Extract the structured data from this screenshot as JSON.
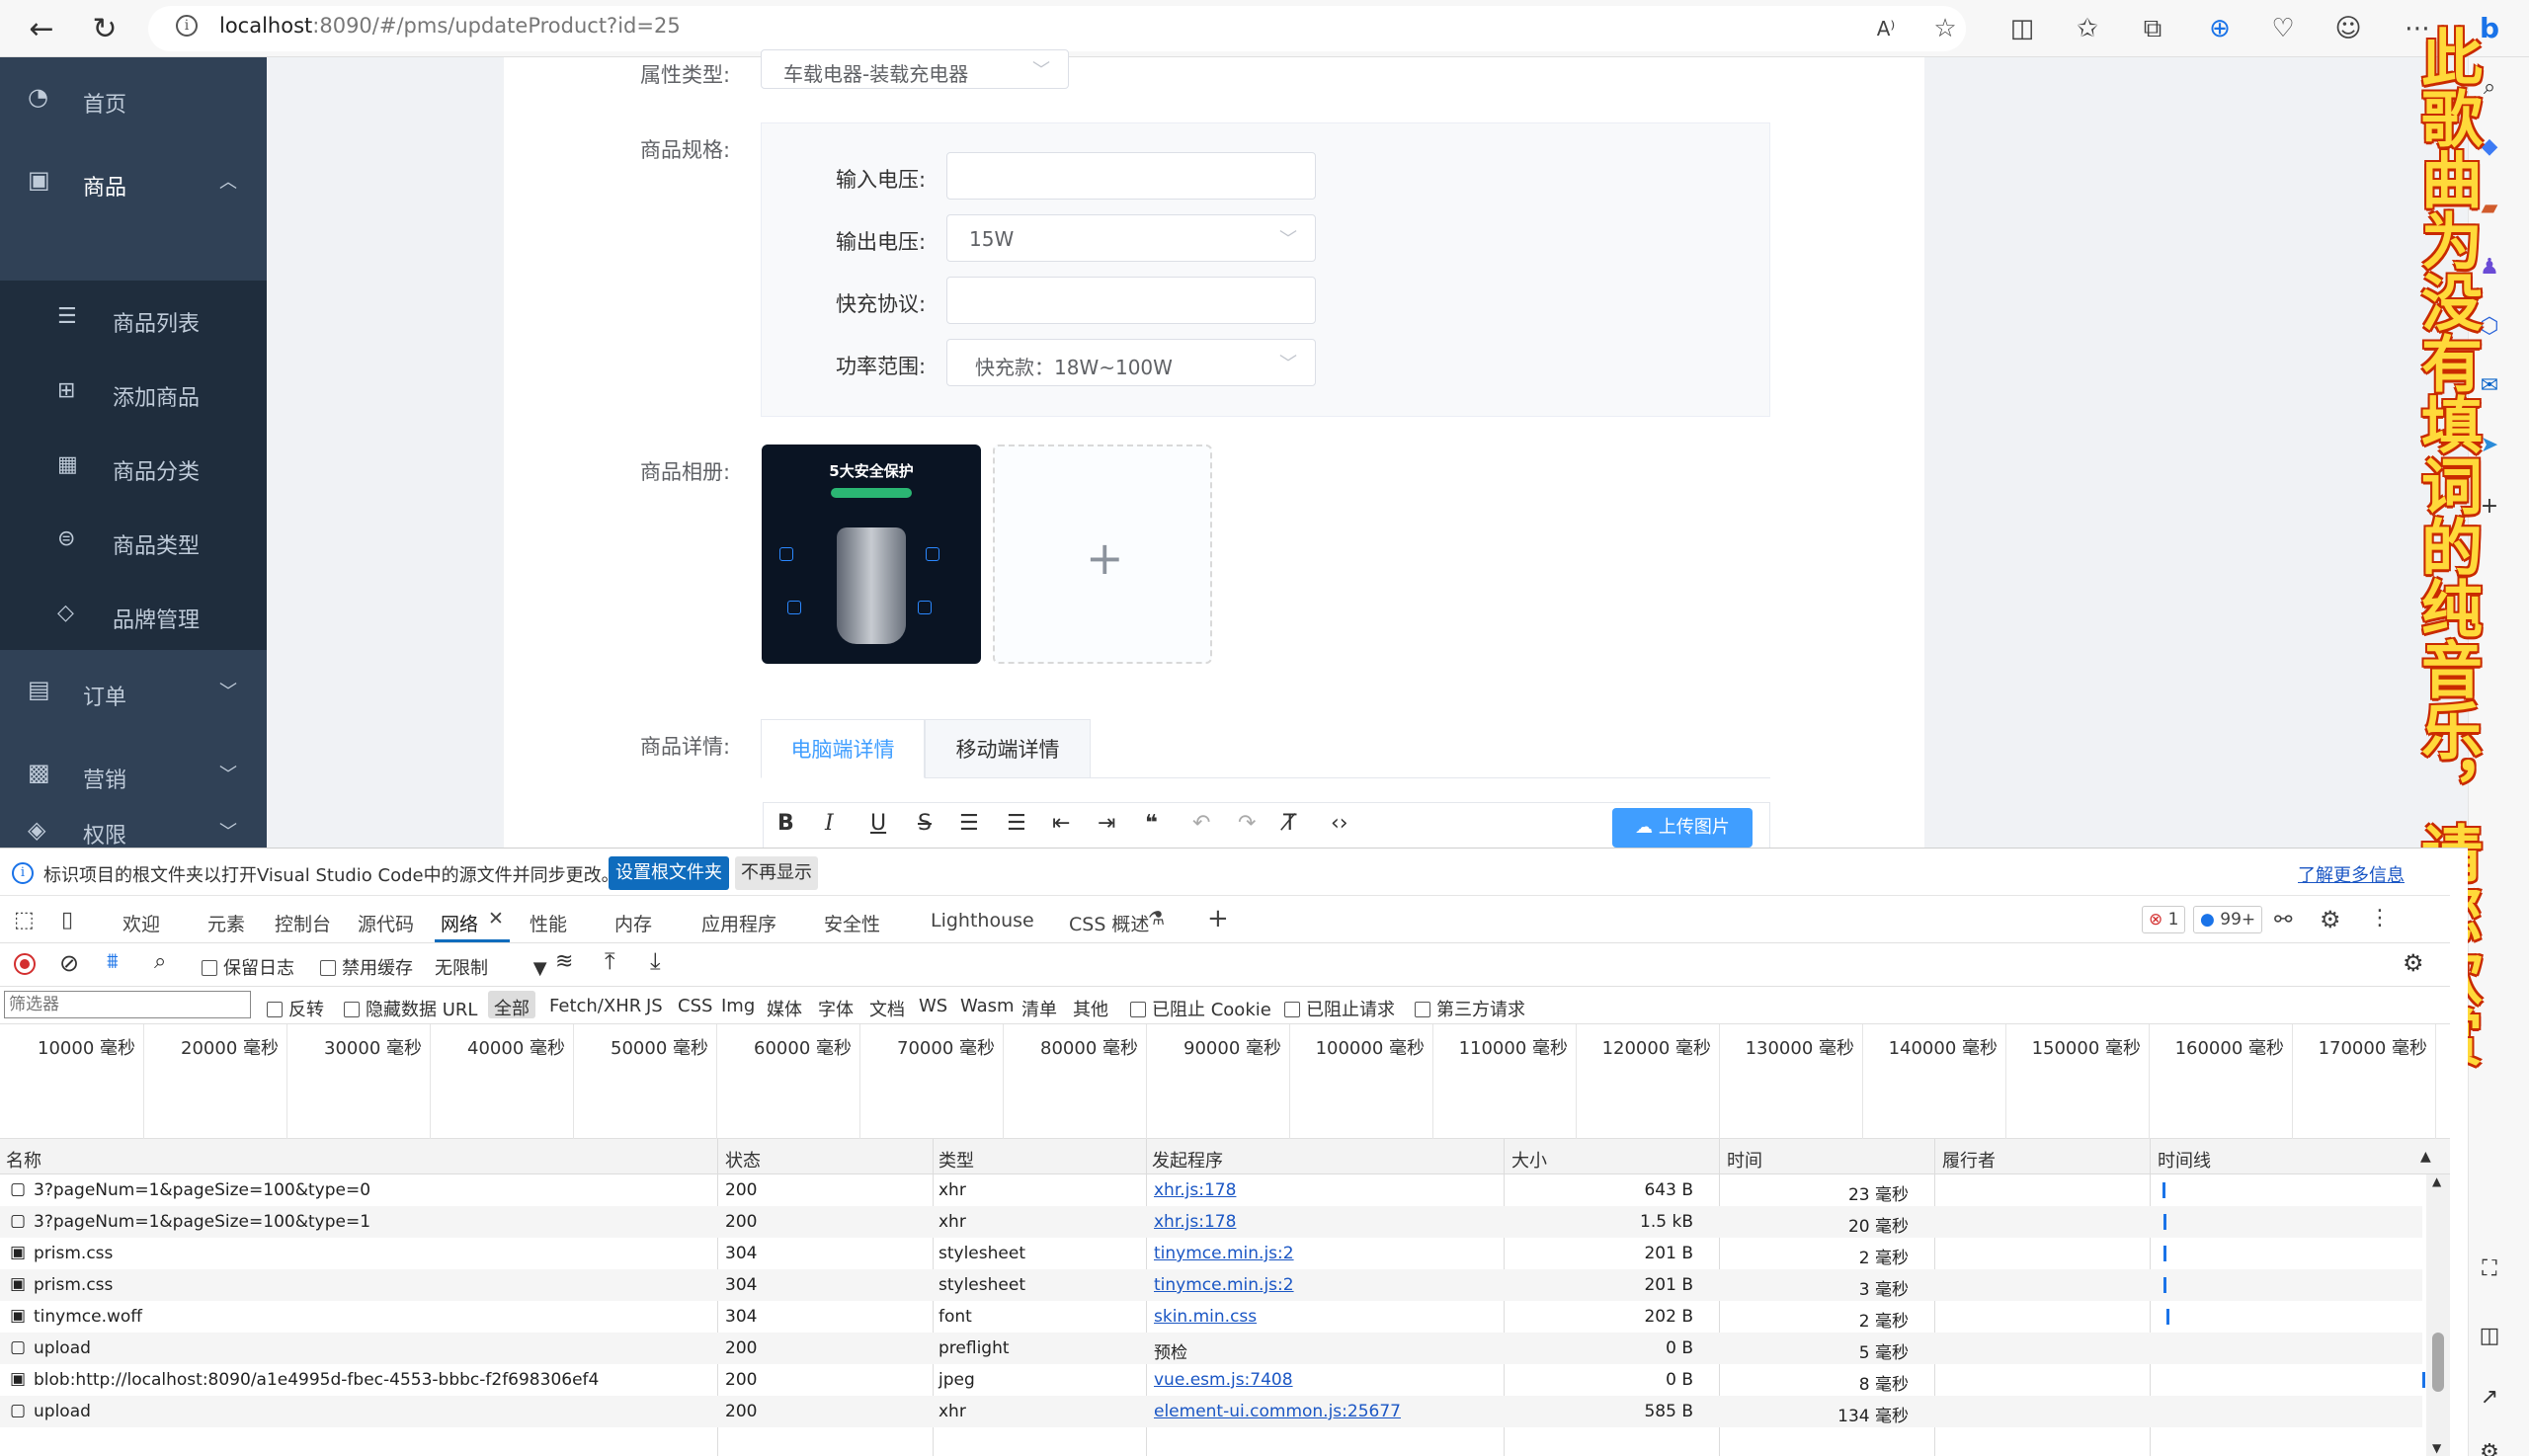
{
  "browser": {
    "url_host": "localhost",
    "url_path": ":8090/#/pms/updateProduct?id=25"
  },
  "sidebar": {
    "home": "首页",
    "product": "商品",
    "sub": [
      {
        "label": "商品列表",
        "icon": "list-icon"
      },
      {
        "label": "添加商品",
        "icon": "add-icon"
      },
      {
        "label": "商品分类",
        "icon": "grid-icon"
      },
      {
        "label": "商品类型",
        "icon": "type-icon"
      },
      {
        "label": "品牌管理",
        "icon": "tag-icon"
      }
    ],
    "order": "订单",
    "marketing": "营销",
    "permission": "权限"
  },
  "form": {
    "attr_type_label": "属性类型:",
    "attr_type_value": "车载电器-装载充电器",
    "spec_label": "商品规格:",
    "spec_rows": [
      {
        "label": "输入电压:",
        "value": "",
        "kind": "input"
      },
      {
        "label": "输出电压:",
        "value": "15W",
        "kind": "select"
      },
      {
        "label": "快充协议:",
        "value": "",
        "kind": "input"
      },
      {
        "label": "功率范围:",
        "value": "快充款：18W~100W",
        "kind": "select"
      }
    ],
    "album_label": "商品相册:",
    "album_image_title": "5大安全保护",
    "detail_label": "商品详情:",
    "tabs": [
      "电脑端详情",
      "移动端详情"
    ],
    "upload_button": "上传图片"
  },
  "lyrics": "此歌曲为没有填词的纯音乐，请您欣赏",
  "devtools": {
    "info_text": "标识项目的根文件夹以打开Visual Studio Code中的源文件并同步更改。",
    "info_set_button": "设置根文件夹",
    "info_dismiss_button": "不再显示",
    "info_learn_more": "了解更多信息",
    "tabs": [
      "欢迎",
      "元素",
      "控制台",
      "源代码",
      "网络",
      "性能",
      "内存",
      "应用程序",
      "安全性",
      "Lighthouse",
      "CSS 概述"
    ],
    "active_tab": "网络",
    "error_count": "1",
    "message_count": "99+",
    "toolbar": {
      "preserve_log": "保留日志",
      "disable_cache": "禁用缓存",
      "throttle": "无限制"
    },
    "filter": {
      "placeholder": "筛选器",
      "invert": "反转",
      "hide_data_urls": "隐藏数据 URL",
      "types": [
        "全部",
        "Fetch/XHR",
        "JS",
        "CSS",
        "Img",
        "媒体",
        "字体",
        "文档",
        "WS",
        "Wasm",
        "清单",
        "其他"
      ],
      "blocked_cookies": "已阻止 Cookie",
      "blocked_requests": "已阻止请求",
      "third_party": "第三方请求"
    },
    "timeline_ticks": [
      "10000 毫秒",
      "20000 毫秒",
      "30000 毫秒",
      "40000 毫秒",
      "50000 毫秒",
      "60000 毫秒",
      "70000 毫秒",
      "80000 毫秒",
      "90000 毫秒",
      "100000 毫秒",
      "110000 毫秒",
      "120000 毫秒",
      "130000 毫秒",
      "140000 毫秒",
      "150000 毫秒",
      "160000 毫秒",
      "170000 毫秒"
    ],
    "columns": {
      "name": "名称",
      "status": "状态",
      "type": "类型",
      "initiator": "发起程序",
      "size": "大小",
      "time": "时间",
      "fulfilled_by": "履行者",
      "waterfall": "时间线"
    },
    "rows": [
      {
        "name": "3?pageNum=1&pageSize=100&type=0",
        "status": "200",
        "type": "xhr",
        "initiator": "xhr.js:178",
        "size": "643 B",
        "time": "23 毫秒"
      },
      {
        "name": "3?pageNum=1&pageSize=100&type=1",
        "status": "200",
        "type": "xhr",
        "initiator": "xhr.js:178",
        "size": "1.5 kB",
        "time": "20 毫秒"
      },
      {
        "name": "prism.css",
        "status": "304",
        "type": "stylesheet",
        "initiator": "tinymce.min.js:2",
        "size": "201 B",
        "time": "2 毫秒"
      },
      {
        "name": "prism.css",
        "status": "304",
        "type": "stylesheet",
        "initiator": "tinymce.min.js:2",
        "size": "201 B",
        "time": "3 毫秒"
      },
      {
        "name": "tinymce.woff",
        "status": "304",
        "type": "font",
        "initiator": "skin.min.css",
        "size": "202 B",
        "time": "2 毫秒"
      },
      {
        "name": "upload",
        "status": "200",
        "type": "preflight",
        "initiator": "预检",
        "size": "0 B",
        "time": "5 毫秒"
      },
      {
        "name": "blob:http://localhost:8090/a1e4995d-fbec-4553-bbbc-f2f698306ef4",
        "status": "200",
        "type": "jpeg",
        "initiator": "vue.esm.js:7408",
        "size": "0 B",
        "time": "8 毫秒"
      },
      {
        "name": "upload",
        "status": "200",
        "type": "xhr",
        "initiator": "element-ui.common.js:25677",
        "size": "585 B",
        "time": "134 毫秒"
      }
    ]
  }
}
